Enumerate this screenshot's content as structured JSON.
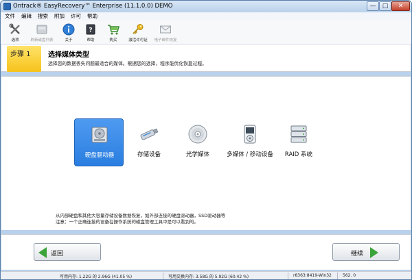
{
  "window": {
    "title": "Ontrack® EasyRecovery™ Enterprise (11.1.0.0) DEMO",
    "controls": {
      "minimize": "—",
      "maximize": "□",
      "close": "✕"
    }
  },
  "menu": [
    "文件",
    "编辑",
    "搜索",
    "附加",
    "许可",
    "帮助"
  ],
  "toolbar": {
    "items": [
      {
        "label": "选项",
        "icon": "tools-icon",
        "enabled": true
      },
      {
        "label": "刷新磁盘列表",
        "icon": "refresh-disk-icon",
        "enabled": false
      },
      {
        "label": "关于",
        "icon": "info-icon",
        "enabled": true
      },
      {
        "label": "帮助",
        "icon": "help-book-icon",
        "enabled": true
      },
      {
        "label": "购买",
        "icon": "cart-icon",
        "enabled": true
      },
      {
        "label": "激活许可证",
        "icon": "key-icon",
        "enabled": true
      },
      {
        "label": "电子邮件恢复",
        "icon": "envelope-icon",
        "enabled": false
      }
    ]
  },
  "step": {
    "label": "步骤 1",
    "title": "选择媒体类型",
    "description": "选择您的数据丢失问题最适合的媒体。根据您的选择，程序能优化恢复过程。"
  },
  "media": [
    {
      "label": "硬盘驱动器",
      "icon": "hard-drive-icon",
      "selected": true
    },
    {
      "label": "存储设备",
      "icon": "usb-drive-icon",
      "selected": false
    },
    {
      "label": "光学媒体",
      "icon": "optical-disc-icon",
      "selected": false
    },
    {
      "label": "多媒体 / 移动设备",
      "icon": "media-player-icon",
      "selected": false
    },
    {
      "label": "RAID 系统",
      "icon": "raid-icon",
      "selected": false
    }
  ],
  "info": {
    "line1": "从内部硬盘和其他大容量存储设备数据恢复，如外部连接的硬盘驱动器，SSD驱动器等",
    "line2": "注意：一个正确连接的设备在操作系统的磁盘管理工具中是可以看到的。"
  },
  "nav": {
    "back": "返回",
    "next": "继续"
  },
  "status": {
    "memory": "可用内存: 1.22G 的 2.96G (41.05 %)",
    "swap": "可用交换内存: 3.58G 的 5.92G (60.42 %)",
    "build": "r8363:8419-Win32",
    "code": "562. 0"
  },
  "colors": {
    "selected_tile": "#2a7ee0",
    "step_badge": "#f6c21a",
    "arrow": "#3aa33a",
    "title_bar": "#b9d1ea"
  }
}
